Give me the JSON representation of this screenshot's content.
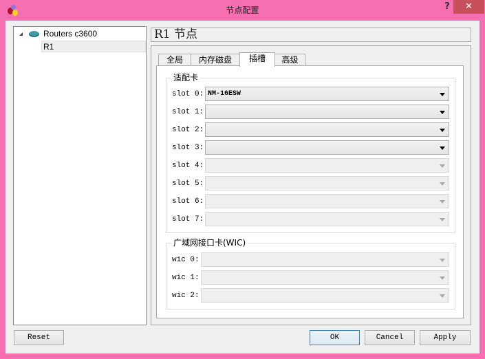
{
  "window": {
    "title": "节点配置",
    "help_label": "?",
    "close_label": "✕",
    "icon": "app-icon"
  },
  "tree": {
    "root": {
      "label": "Routers c3600",
      "icon": "router-icon",
      "expanded": true
    },
    "children": [
      {
        "label": "R1",
        "selected": true
      }
    ]
  },
  "header": {
    "title": "R1  节点"
  },
  "tabs": [
    {
      "label": "全局",
      "active": false
    },
    {
      "label": "内存磁盘",
      "active": false
    },
    {
      "label": "插槽",
      "active": true
    },
    {
      "label": "高级",
      "active": false
    }
  ],
  "adapters": {
    "title": "适配卡",
    "slots": [
      {
        "label": "slot 0:",
        "value": "NM-16ESW",
        "enabled": true
      },
      {
        "label": "slot 1:",
        "value": "",
        "enabled": true
      },
      {
        "label": "slot 2:",
        "value": "",
        "enabled": true
      },
      {
        "label": "slot 3:",
        "value": "",
        "enabled": true
      },
      {
        "label": "slot 4:",
        "value": "",
        "enabled": false
      },
      {
        "label": "slot 5:",
        "value": "",
        "enabled": false
      },
      {
        "label": "slot 6:",
        "value": "",
        "enabled": false
      },
      {
        "label": "slot 7:",
        "value": "",
        "enabled": false
      }
    ]
  },
  "wics": {
    "title": "广域网接口卡(WIC)",
    "slots": [
      {
        "label": "wic 0:",
        "value": "",
        "enabled": false
      },
      {
        "label": "wic 1:",
        "value": "",
        "enabled": false
      },
      {
        "label": "wic 2:",
        "value": "",
        "enabled": false
      }
    ]
  },
  "buttons": {
    "reset": "Reset",
    "ok": "OK",
    "cancel": "Cancel",
    "apply": "Apply"
  },
  "colors": {
    "frame": "#f66fb0",
    "close": "#c7505a",
    "default_button_border": "#3c7fb1"
  }
}
